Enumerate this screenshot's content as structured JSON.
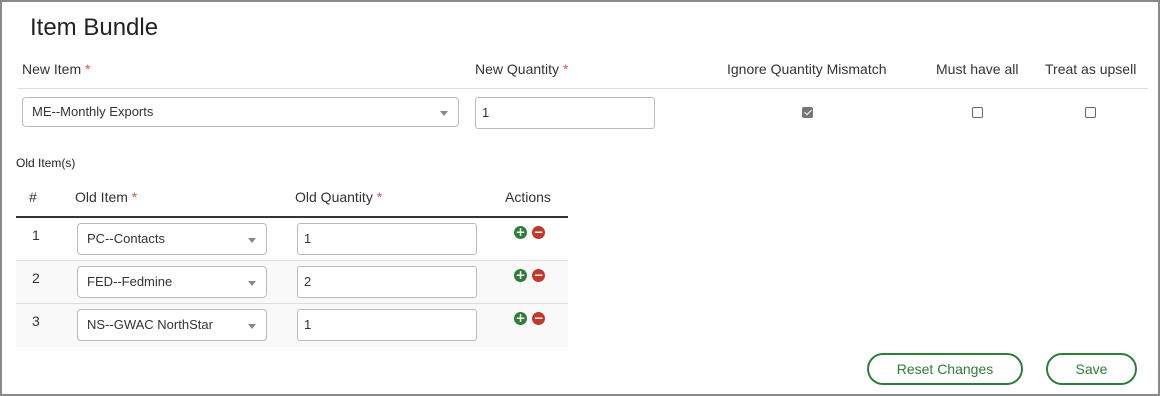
{
  "title": "Item Bundle",
  "required_mark": "*",
  "new_item": {
    "headers": {
      "new_item": "New Item",
      "new_quantity": "New Quantity",
      "ignore_quantity_mismatch": "Ignore Quantity Mismatch",
      "must_have_all": "Must have all",
      "treat_as_upsell": "Treat as upsell"
    },
    "item_value": "ME--Monthly Exports",
    "quantity_value": "1",
    "ignore_quantity_mismatch": true,
    "must_have_all": false,
    "treat_as_upsell": false
  },
  "old_items": {
    "section_title": "Old Item(s)",
    "headers": {
      "num": "#",
      "old_item": "Old Item",
      "old_quantity": "Old Quantity",
      "actions": "Actions"
    },
    "rows": [
      {
        "num": "1",
        "item": "PC--Contacts",
        "quantity": "1"
      },
      {
        "num": "2",
        "item": "FED--Fedmine",
        "quantity": "2"
      },
      {
        "num": "3",
        "item": "NS--GWAC NorthStar",
        "quantity": "1"
      }
    ]
  },
  "icons": {
    "add": "plus-circle-icon",
    "remove": "minus-circle-icon",
    "dropdown": "chevron-down-icon"
  },
  "colors": {
    "accent": "#2e7d3a",
    "danger": "#c0392b",
    "required": "#d9534f"
  },
  "buttons": {
    "reset": "Reset Changes",
    "save": "Save"
  }
}
